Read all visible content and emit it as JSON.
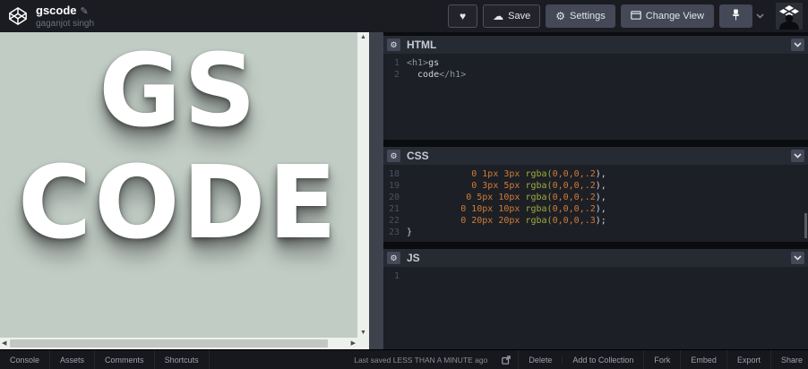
{
  "colors": {
    "preview_bg": "#c1ccc5",
    "syntax_number": "#cf7d34",
    "syntax_function": "#9fab3a",
    "syntax_tag": "#8b93a8",
    "chip_bg": "#444857"
  },
  "icons": {
    "heart": "♥",
    "cloud": "☁",
    "gear": "⚙",
    "pencil": "✎"
  },
  "header": {
    "title": "gscode",
    "author": "gaganjot singh",
    "save_label": "Save",
    "settings_label": "Settings",
    "change_view_label": "Change View"
  },
  "preview": {
    "heading_line1": "GS",
    "heading_line2": "CODE"
  },
  "panels": [
    {
      "label": "HTML",
      "lines": [
        {
          "n": "1",
          "tokens": [
            {
              "t": "<h1>",
              "c": "tag"
            },
            {
              "t": "gs",
              "c": "plain"
            }
          ]
        },
        {
          "n": "2",
          "tokens": [
            {
              "t": "  code",
              "c": "plain"
            },
            {
              "t": "</h1>",
              "c": "tag"
            }
          ]
        }
      ]
    },
    {
      "label": "CSS",
      "lines": [
        {
          "n": "18",
          "tokens": [
            {
              "t": "            0 1px 3px ",
              "c": "num"
            },
            {
              "t": "rgba(",
              "c": "fn"
            },
            {
              "t": "0,0,0,.2",
              "c": "num"
            },
            {
              "t": "),",
              "c": "plain"
            }
          ]
        },
        {
          "n": "19",
          "tokens": [
            {
              "t": "            0 3px 5px ",
              "c": "num"
            },
            {
              "t": "rgba(",
              "c": "fn"
            },
            {
              "t": "0,0,0,.2",
              "c": "num"
            },
            {
              "t": "),",
              "c": "plain"
            }
          ]
        },
        {
          "n": "20",
          "tokens": [
            {
              "t": "           0 5px 10px ",
              "c": "num"
            },
            {
              "t": "rgba(",
              "c": "fn"
            },
            {
              "t": "0,0,0,.2",
              "c": "num"
            },
            {
              "t": "),",
              "c": "plain"
            }
          ]
        },
        {
          "n": "21",
          "tokens": [
            {
              "t": "          0 10px 10px ",
              "c": "num"
            },
            {
              "t": "rgba(",
              "c": "fn"
            },
            {
              "t": "0,0,0,.2",
              "c": "num"
            },
            {
              "t": "),",
              "c": "plain"
            }
          ]
        },
        {
          "n": "22",
          "tokens": [
            {
              "t": "          0 20px 20px ",
              "c": "num"
            },
            {
              "t": "rgba(",
              "c": "fn"
            },
            {
              "t": "0,0,0,.3",
              "c": "num"
            },
            {
              "t": ");",
              "c": "plain"
            }
          ]
        },
        {
          "n": "23",
          "tokens": [
            {
              "t": "}",
              "c": "plain"
            }
          ]
        }
      ]
    },
    {
      "label": "JS",
      "lines": [
        {
          "n": "1",
          "tokens": []
        }
      ]
    }
  ],
  "footer": {
    "left_items": [
      "Console",
      "Assets",
      "Comments",
      "Shortcuts"
    ],
    "last_saved": "Last saved LESS THAN A MINUTE ago",
    "right_items": [
      "Delete",
      "Add to Collection",
      "Fork",
      "Embed",
      "Export",
      "Share"
    ]
  }
}
